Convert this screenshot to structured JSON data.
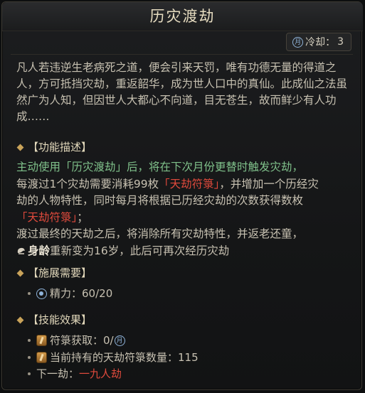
{
  "title": "历灾渡劫",
  "cooldown": {
    "icon": "moon-calendar-icon",
    "moon_glyph": "月",
    "label": "冷却：",
    "value": "3"
  },
  "lore": "凡人若违逆生老病死之道，便会引来天罚，唯有功德无量的得道之人，方可抵挡灾劫，重返韶华，成为世人口中的真仙。此成仙之法虽然广为人知，但因世人大都心不向道，目无苍生，故而鲜少有人功成……",
  "function_section": {
    "title": "【功能描述】",
    "line1": "主动使用「历灾渡劫」后，将在下次月份更替时触发灾劫，",
    "line2_a": "每渡过1个灾劫需要消耗99枚",
    "line2_red": "「天劫符箓」",
    "line2_b": "，并增加一个历经灾",
    "line3": "劫的人物特性，同时每月将根据已历经灾劫的次数获得数枚",
    "line4_red": "「天劫符箓」",
    "line4_b": "；",
    "line5": "渡过最终的天劫之后，将消除所有灾劫特性，并返老还童，",
    "line6_bold": "身龄",
    "line6_b": "重新变为16岁，此后可再次经历灾劫"
  },
  "requirement_section": {
    "title": "【施展需要】",
    "energy_label": "精力：",
    "energy_value": "60/20"
  },
  "effect_section": {
    "title": "【技能效果】",
    "gain_label": "符箓获取：",
    "gain_value": "0/",
    "gain_moon": "月",
    "held_label": "当前持有的天劫符箓数量：",
    "held_value": "115",
    "next_label": "下一劫：",
    "next_value": "一九人劫"
  },
  "colors": {
    "accent_red": "#e04a3c",
    "accent_green": "#7fc08a",
    "title_gold": "#e6dcc0"
  }
}
